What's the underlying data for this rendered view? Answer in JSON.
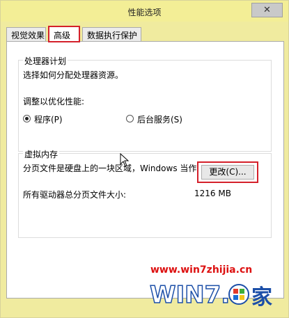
{
  "window": {
    "title": "性能选项",
    "close_glyph": "✕"
  },
  "tabs": [
    {
      "label": "视觉效果"
    },
    {
      "label": "高级",
      "selected": true
    },
    {
      "label": "数据执行保护"
    }
  ],
  "processor": {
    "title": "处理器计划",
    "description": "选择如何分配处理器资源。",
    "adjust_label": "调整以优化性能:",
    "options": [
      {
        "label": "程序(P)",
        "checked": true
      },
      {
        "label": "后台服务(S)",
        "checked": false
      }
    ]
  },
  "virtual_memory": {
    "title": "虚拟内存",
    "description": "分页文件是硬盘上的一块区域，Windows 当作 RAM 使用。",
    "total_label": "所有驱动器总分页文件大小:",
    "total_value": "1216 MB",
    "change_label": "更改(C)..."
  },
  "watermark": {
    "url": "www.win7zhijia.cn",
    "logo_text": "WIN7之家"
  },
  "colors": {
    "highlight": "#d4202a",
    "window_bg": "#f0eb9f"
  }
}
